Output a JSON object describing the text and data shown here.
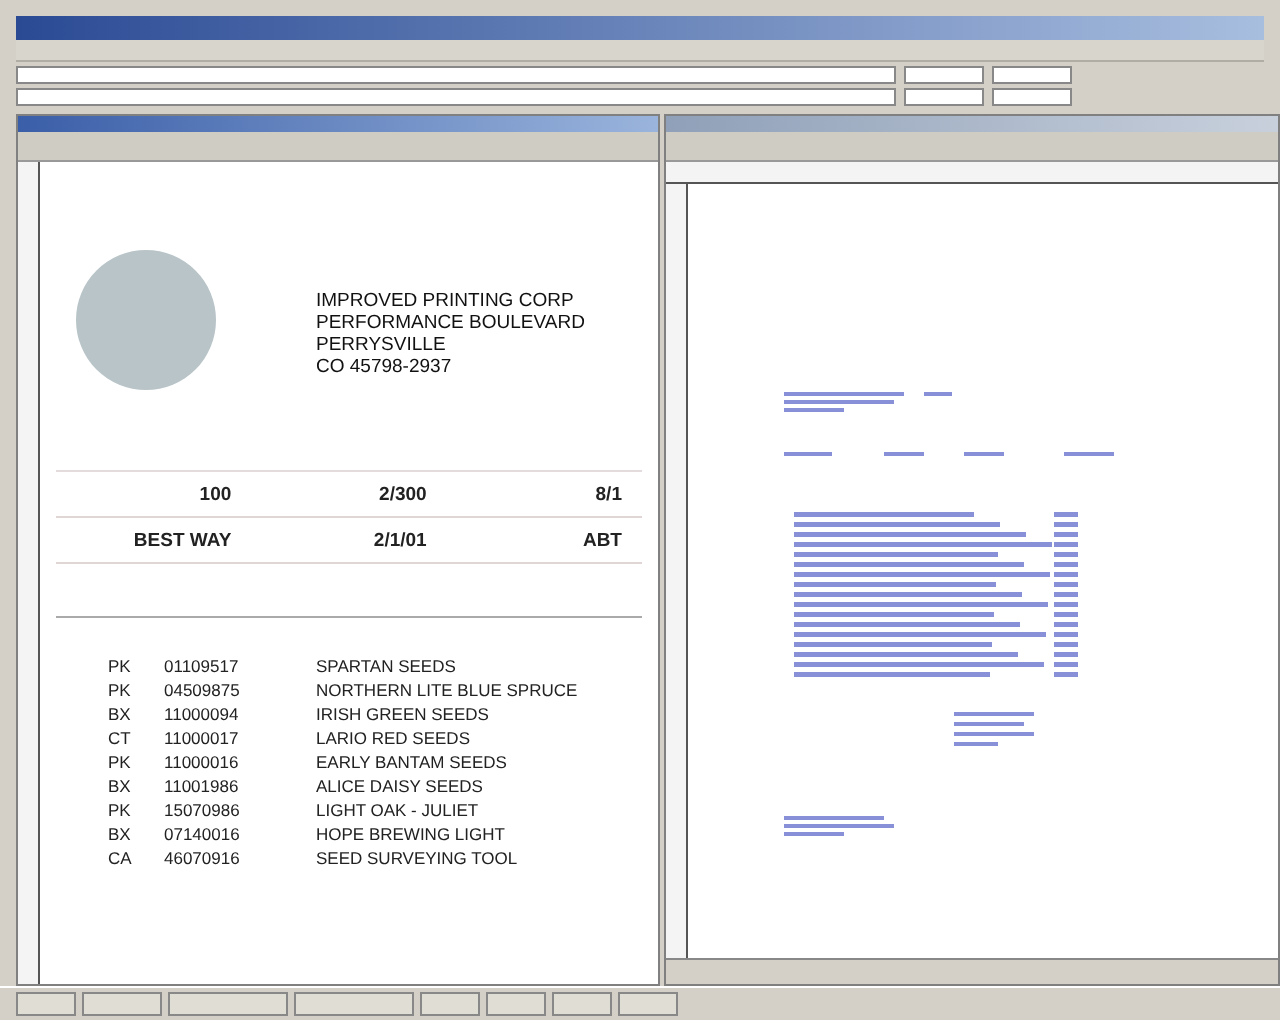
{
  "address": [
    "IMPROVED PRINTING CORP",
    "PERFORMANCE BOULEVARD",
    "PERRYSVILLE",
    "CO 45798-2937"
  ],
  "field_rows": [
    [
      "100",
      "2/300",
      "8/1"
    ],
    [
      "BEST WAY",
      "2/1/01",
      "ABT"
    ]
  ],
  "items": [
    {
      "unit": "PK",
      "number": "01109517",
      "description": "SPARTAN SEEDS"
    },
    {
      "unit": "PK",
      "number": "04509875",
      "description": "NORTHERN LITE BLUE SPRUCE"
    },
    {
      "unit": "BX",
      "number": "11000094",
      "description": "IRISH GREEN SEEDS"
    },
    {
      "unit": "CT",
      "number": "11000017",
      "description": "LARIO RED SEEDS"
    },
    {
      "unit": "PK",
      "number": "11000016",
      "description": "EARLY BANTAM SEEDS"
    },
    {
      "unit": "BX",
      "number": "11001986",
      "description": "ALICE DAISY SEEDS"
    },
    {
      "unit": "PK",
      "number": "15070986",
      "description": "LIGHT OAK - JULIET"
    },
    {
      "unit": "BX",
      "number": "07140016",
      "description": "HOPE BREWING LIGHT"
    },
    {
      "unit": "CA",
      "number": "46070916",
      "description": "SEED SURVEYING TOOL"
    }
  ]
}
